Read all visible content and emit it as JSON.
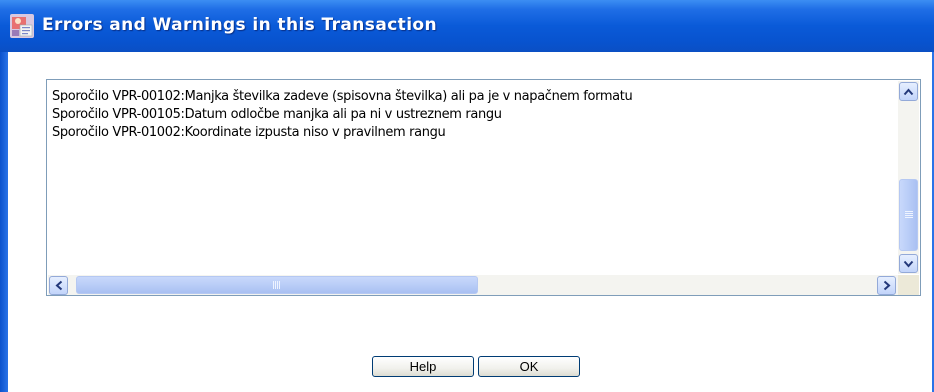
{
  "window": {
    "title": "Errors and Warnings in this Transaction",
    "icon": "app-icon"
  },
  "messages": [
    "Sporočilo VPR-00102:Manjka številka zadeve (spisovna številka) ali pa je v napačnem formatu",
    "Sporočilo VPR-00105:Datum odločbe manjka ali pa ni v ustreznem rangu",
    "Sporočilo VPR-01002:Koordinate izpusta niso v pravilnem rangu"
  ],
  "buttons": {
    "help_label": "Help",
    "ok_label": "OK"
  },
  "colors": {
    "titlebar": "#0a5ad8",
    "title_text": "#ffffff",
    "scroll_thumb": "#b9cdf7"
  }
}
